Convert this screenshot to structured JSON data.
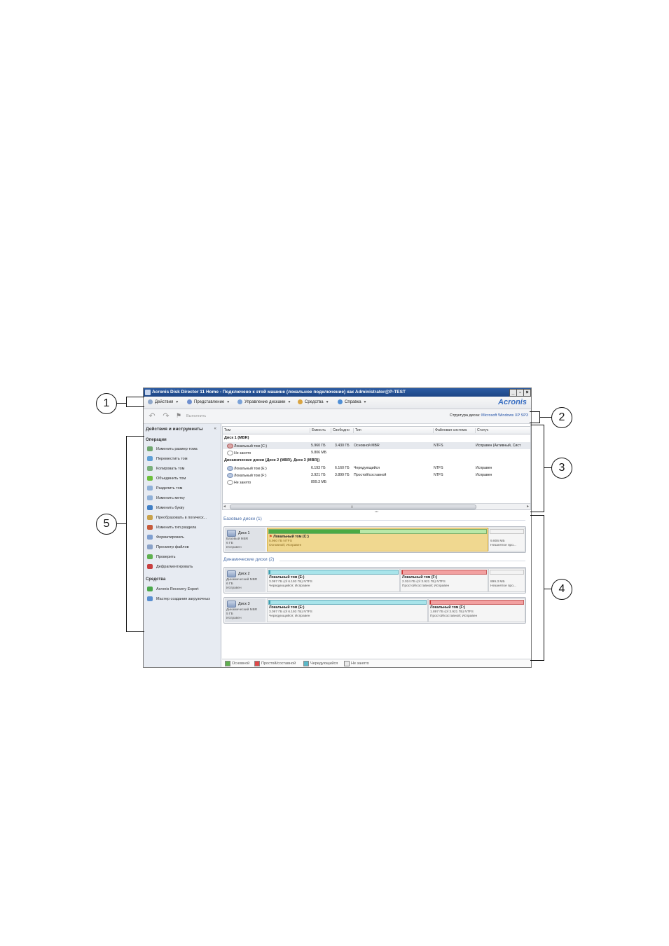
{
  "window": {
    "title": "Acronis Disk Director 11 Home - Подключено к этой машине (локальное подключение) как Administrator@P-TEST",
    "controls": {
      "minimize": "_",
      "restore": "▫",
      "close": "×"
    }
  },
  "menu": {
    "items": [
      {
        "label": "Действия",
        "icon": "actions-icon",
        "color": "#8fa7c9"
      },
      {
        "label": "Представление",
        "icon": "view-icon",
        "color": "#6f8fcf"
      },
      {
        "label": "Управление дисками",
        "icon": "disk-management-icon",
        "color": "#7aa2d8"
      },
      {
        "label": "Средства",
        "icon": "tools-icon",
        "color": "#d9a441"
      },
      {
        "label": "Справка",
        "icon": "help-icon",
        "color": "#4f8fd6"
      }
    ],
    "logo": "Acronis"
  },
  "toolbar": {
    "undo_icon": "↶",
    "redo_icon": "↷",
    "commit_label": "Выполнить",
    "disk_structure_label": "Структура диска:",
    "disk_structure_value": "Microsoft Windows XP SP3"
  },
  "sidebar": {
    "title": "Действия и инструменты",
    "collapse": "«",
    "operations_label": "Операции",
    "operations": [
      {
        "label": "Изменить размер тома",
        "color": "#6fa66f"
      },
      {
        "label": "Переместить том",
        "color": "#5f9fd6"
      },
      {
        "label": "Копировать том",
        "color": "#7ab07a"
      },
      {
        "label": "Объединить том",
        "color": "#6cbf3c"
      },
      {
        "label": "Разделить том",
        "color": "#8fb0d8"
      },
      {
        "label": "Изменить метку",
        "color": "#8fb0d8"
      },
      {
        "label": "Изменить букву",
        "color": "#3f7fc6"
      },
      {
        "label": "Преобразовать в логическ...",
        "color": "#c9a24a"
      },
      {
        "label": "Изменить тип раздела",
        "color": "#c75a3a"
      },
      {
        "label": "Форматировать",
        "color": "#7f9fd0"
      },
      {
        "label": "Просмотр файлов",
        "color": "#8aa2c8"
      },
      {
        "label": "Проверить",
        "color": "#5fb04f"
      },
      {
        "label": "Дефрагментировать",
        "color": "#c84040"
      }
    ],
    "tools_label": "Средства",
    "tools": [
      {
        "label": "Acronis Recovery Expert",
        "color": "#4aa84a"
      },
      {
        "label": "Мастер создания загрузочных",
        "color": "#5a8fd0"
      }
    ]
  },
  "volumes_table": {
    "columns": [
      "Том",
      "Емкость",
      "Свободно",
      "Тип",
      "Файловая система",
      "Статус"
    ],
    "groups": [
      {
        "label": "Диск 1 (MBR)",
        "rows": [
          {
            "name": "Локальный том (C:)",
            "capacity": "5.960 ГБ",
            "free": "3.430 ГБ",
            "type": "Основной MBR",
            "fs": "NTFS",
            "status": "Исправен (Активный, Сист"
          },
          {
            "name": "Не занято",
            "capacity": "9.806 МБ",
            "free": "",
            "type": "",
            "fs": "",
            "status": ""
          }
        ]
      },
      {
        "label": "Динамические диски (Диск 2 (MBR), Диск 3 (MBR))",
        "rows": [
          {
            "name": "Локальный том (E:)",
            "capacity": "6.193 ГБ",
            "free": "6.160 ГБ",
            "type": "Чередующийся",
            "fs": "NTFS",
            "status": "Исправен"
          },
          {
            "name": "Локальный том (F:)",
            "capacity": "3.921 ГБ",
            "free": "3.899 ГБ",
            "type": "Простой/составной",
            "fs": "NTFS",
            "status": "Исправен"
          },
          {
            "name": "Не занято",
            "capacity": "899.3 МБ",
            "free": "",
            "type": "",
            "fs": "",
            "status": ""
          }
        ]
      }
    ],
    "scroll_left": "◂",
    "scroll_right": "▸",
    "scroll_grip": "|||"
  },
  "splitter": "•••",
  "disk_panel": {
    "basic_label": "Базовые диски (1)",
    "dynamic_label": "Динамические диски (2)",
    "disks": [
      {
        "name": "Диск 1",
        "type": "Базовый MBR",
        "size": "6 ГБ",
        "status": "Исправен",
        "partitions": [
          {
            "title": "Локальный том (C:)",
            "line2": "5.960 ГБ NTFS",
            "line3": "Основной; Исправен",
            "used": 0.42,
            "color": "#f0d890"
          },
          {
            "title": "",
            "line2": "9.806 МБ",
            "line3": "Незанятое про...",
            "used": 0,
            "color": "#f5f5f5"
          }
        ]
      },
      {
        "name": "Диск 2",
        "type": "Динамический MBR",
        "size": "6 ГБ",
        "status": "Исправен",
        "partitions": [
          {
            "title": "Локальный том (E:)",
            "line2": "3.097 ГБ (of 6.193 ГБ) NTFS",
            "line3": "Чередующийся; Исправен",
            "used": 0.01,
            "color": "#a8e4ea"
          },
          {
            "title": "Локальный том (F:)",
            "line2": "2.024 ГБ (of 3.921 ГБ) NTFS",
            "line3": "Простой/составной; Исправен",
            "used": 0.01,
            "color": "#f2a0a0"
          },
          {
            "title": "",
            "line2": "899.3 МБ",
            "line3": "Незанятое про...",
            "used": 0,
            "color": "#f5f5f5"
          }
        ]
      },
      {
        "name": "Диск 3",
        "type": "Динамический MBR",
        "size": "5 ГБ",
        "status": "Исправен",
        "partitions": [
          {
            "title": "Локальный том (E:)",
            "line2": "3.097 ГБ (of 6.193 ГБ) NTFS",
            "line3": "Чередующийся; Исправен",
            "used": 0.01,
            "color": "#a8e4ea"
          },
          {
            "title": "Локальный том (F:)",
            "line2": "1.897 ГБ (of 3.921 ГБ) NTFS",
            "line3": "Простой/составной; Исправен",
            "used": 0.01,
            "color": "#f2a0a0"
          }
        ]
      }
    ],
    "legend": [
      {
        "label": "Основной",
        "color": "#5fb04f"
      },
      {
        "label": "Простой/составной",
        "color": "#e04848"
      },
      {
        "label": "Чередующийся",
        "color": "#5ab8c8"
      },
      {
        "label": "Не занято",
        "color": "#e8e8e8"
      }
    ]
  },
  "callouts": [
    "1",
    "2",
    "3",
    "4",
    "5"
  ]
}
